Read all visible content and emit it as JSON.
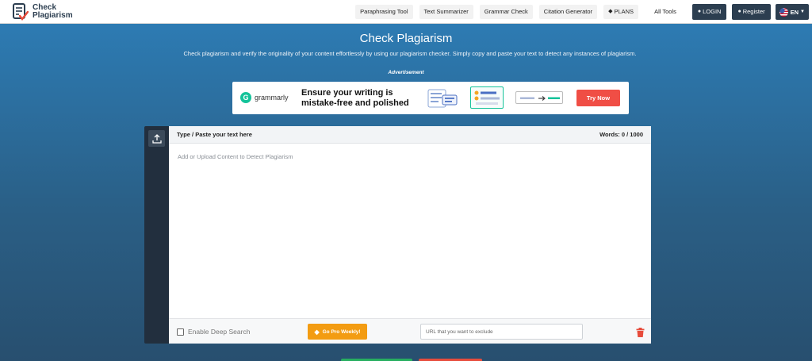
{
  "brand": {
    "line1": "Check",
    "line2": "Plagiarism"
  },
  "nav": {
    "links": [
      "Paraphrasing Tool",
      "Text Summarizer",
      "Grammar Check",
      "Citation Generator"
    ],
    "plans": "PLANS",
    "all_tools": "All Tools",
    "login": "LOGIN",
    "register": "Register",
    "lang": "EN"
  },
  "hero": {
    "title": "Check Plagiarism",
    "subtitle": "Check plagiarism and verify the originality of your content effortlessly by using our plagiarism checker. Simply copy and paste your text to detect any instances of plagiarism.",
    "ad_label": "Advertisement"
  },
  "ad": {
    "brand": "grammarly",
    "headline_1": "Ensure your writing is",
    "headline_2": "mistake-free and polished",
    "cta": "Try Now"
  },
  "editor": {
    "header_label": "Type / Paste your text here",
    "word_count": "Words: 0 / 1000",
    "placeholder": "Add or Upload Content to Detect Plagiarism",
    "deep_search_label": "Enable Deep Search",
    "pro_button": "Go Pro Weekly!",
    "url_placeholder": "URL that you want to exclude"
  },
  "colors": {
    "accent_dark": "#2c3e50",
    "hero_blue": "#2d7bb3",
    "grammarly_green": "#15c39a",
    "cta_red": "#f04e45",
    "pro_orange": "#f39c12"
  }
}
